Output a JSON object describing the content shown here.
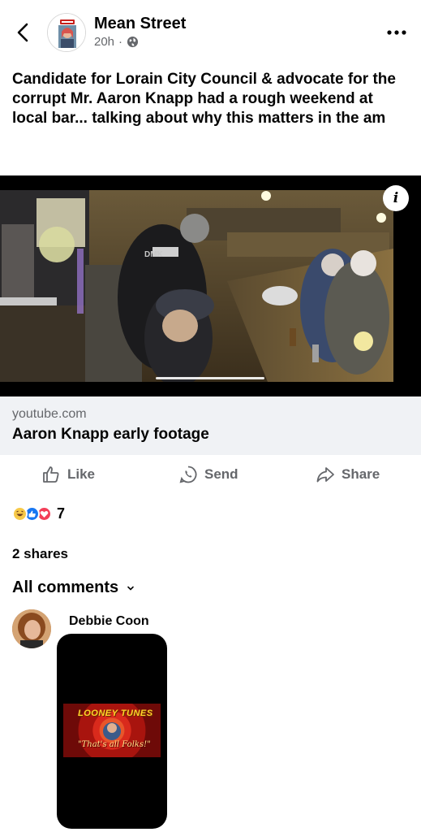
{
  "header": {
    "page_name": "Mean Street",
    "time": "20h",
    "separator": "·",
    "icons": {
      "back": "chevron-left-icon",
      "privacy": "globe-icon",
      "more": "more-horizontal-icon"
    }
  },
  "post": {
    "text": "Candidate for Lorain City Council & advocate for the corrupt Mr. Aaron Knapp had a rough weekend at local bar...  talking about why this matters in the am"
  },
  "video": {
    "info_label": "i",
    "jersey_text": "DMK"
  },
  "link_preview": {
    "domain": "youtube.com",
    "title": "Aaron Knapp early footage"
  },
  "actions": {
    "like": "Like",
    "send": "Send",
    "share": "Share"
  },
  "reactions": {
    "types": [
      "haha",
      "like",
      "love"
    ],
    "count": "7"
  },
  "shares": "2 shares",
  "comments_filter": "All comments",
  "comment": {
    "author": "Debbie Coon",
    "media_title": "LOONEY TUNES",
    "media_caption": "\"That's all Folks!\""
  },
  "colors": {
    "accent": "#1877f2",
    "secondary_text": "#65676b",
    "love": "#f33e58",
    "haha": "#f7c948"
  }
}
